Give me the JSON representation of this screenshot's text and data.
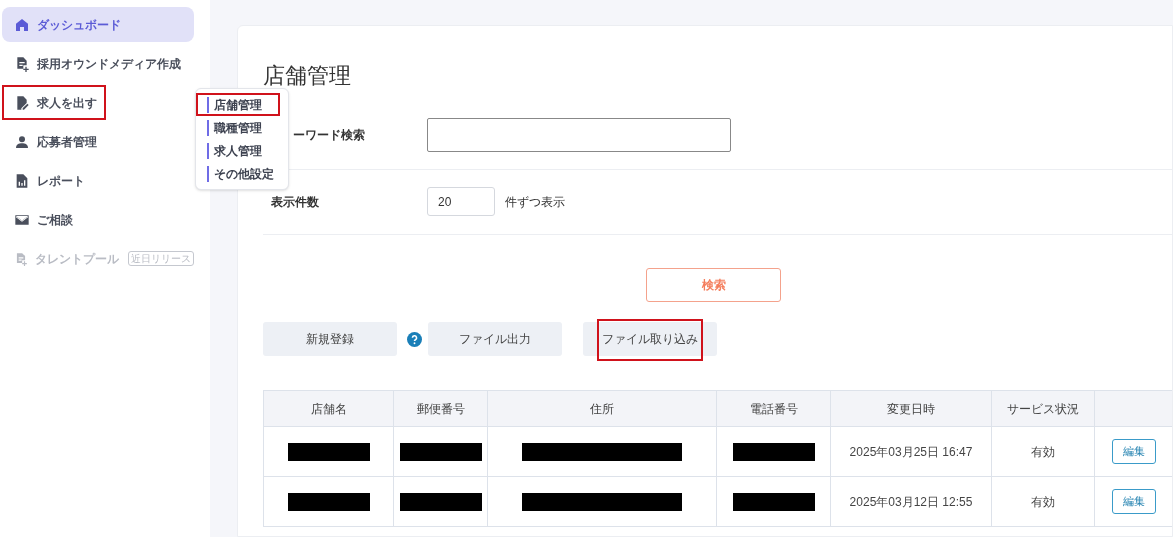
{
  "sidebar": {
    "items": [
      {
        "label": "ダッシュボード",
        "kind": "home",
        "selected": true,
        "highlighted": false,
        "disabled": false
      },
      {
        "label": "採用オウンドメディア作成",
        "kind": "doc-plus",
        "selected": false,
        "highlighted": false,
        "disabled": false
      },
      {
        "label": "求人を出す",
        "kind": "doc-edit",
        "selected": false,
        "highlighted": true,
        "disabled": false
      },
      {
        "label": "応募者管理",
        "kind": "person",
        "selected": false,
        "highlighted": false,
        "disabled": false
      },
      {
        "label": "レポート",
        "kind": "chart-doc",
        "selected": false,
        "highlighted": false,
        "disabled": false
      },
      {
        "label": "ご相談",
        "kind": "mail",
        "selected": false,
        "highlighted": false,
        "disabled": false
      },
      {
        "label": "タレントプール",
        "kind": "doc-plus",
        "selected": false,
        "highlighted": false,
        "disabled": true,
        "badge": "近日リリース"
      }
    ]
  },
  "submenu": {
    "items": [
      {
        "label": "店舗管理",
        "highlighted": true
      },
      {
        "label": "職種管理",
        "highlighted": false
      },
      {
        "label": "求人管理",
        "highlighted": false
      },
      {
        "label": "その他設定",
        "highlighted": false
      }
    ]
  },
  "page_title": "店舗管理",
  "filters": {
    "keyword_label": "ーワード検索",
    "count_label": "表示件数",
    "count_value": "20",
    "count_suffix": "件ずつ表示",
    "search_button": "検索"
  },
  "actions": [
    {
      "label": "新規登録",
      "highlighted": false,
      "help": true
    },
    {
      "label": "ファイル出力",
      "highlighted": false,
      "help": false
    },
    {
      "label": "ファイル取り込み",
      "highlighted": true,
      "help": false
    }
  ],
  "table": {
    "columns": [
      "店舗名",
      "郵便番号",
      "住所",
      "電話番号",
      "変更日時",
      "サービス状況"
    ],
    "rows": [
      {
        "cells": [
          {
            "redacted": true
          },
          {
            "redacted": true
          },
          {
            "redacted": true
          },
          {
            "redacted": true
          },
          {
            "text": "2025年03月25日 16:47"
          },
          {
            "text": "有効"
          }
        ],
        "action": "編集"
      },
      {
        "cells": [
          {
            "redacted": true
          },
          {
            "redacted": true
          },
          {
            "redacted": true
          },
          {
            "redacted": true
          },
          {
            "text": "2025年03月12日 12:55"
          },
          {
            "text": "有効"
          }
        ],
        "action": "編集"
      }
    ]
  }
}
